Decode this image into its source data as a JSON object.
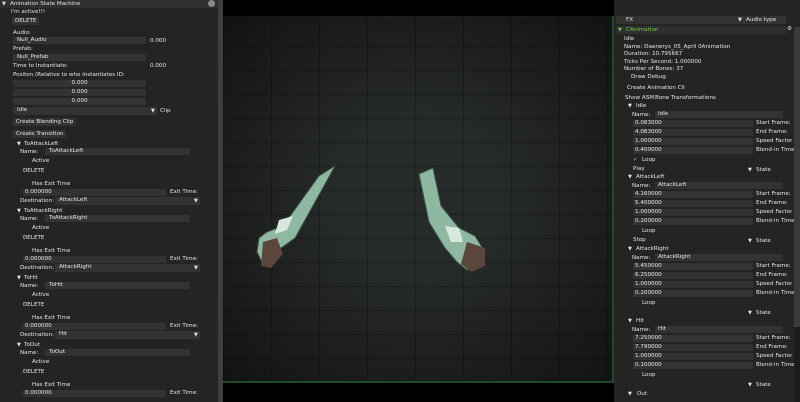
{
  "left_panel": {
    "title": "Animation State Machine",
    "active_label": "I'm active!!!",
    "delete_label": "DELETE",
    "audio_label": "Audio:",
    "audio_name": "Null_Audio",
    "audio_value": "0.000",
    "prefab_label": "Prefab:",
    "prefab_name": "Null_Prefab",
    "time_label": "Time to Instantiate:",
    "time_value": "0.000",
    "position_label": "Positon (Relative to who instantiates ID:",
    "pos_x": "0.000",
    "pos_y": "0.000",
    "pos_z": "0.000",
    "state_select": "Idle",
    "clip_label": "Clip",
    "create_blending": "Create Blending Clip",
    "create_transition": "Create Transition",
    "transitions": [
      {
        "header": "ToAttackLeft",
        "name_label": "Name:",
        "name": "ToAttackLeft",
        "active": "Active",
        "delete": "DELETE",
        "exit_label": "Has Exit Time",
        "time": "0.000000",
        "exit_time": "Exit Time:",
        "dest_label": "Destination:",
        "dest": "AttackLeft"
      },
      {
        "header": "ToAttackRight",
        "name_label": "Name:",
        "name": "ToAttackRight",
        "active": "Active",
        "delete": "DELETE",
        "exit_label": "Has Exit Time",
        "time": "0.000000",
        "exit_time": "Exit Time:",
        "dest_label": "Destination:",
        "dest": "AttackRight"
      },
      {
        "header": "ToHit",
        "name_label": "Name:",
        "name": "ToHit",
        "active": "Active",
        "delete": "DELETE",
        "exit_label": "Has Exit Time",
        "time": "0.000000",
        "exit_time": "Exit Time:",
        "dest_label": "Destination:",
        "dest": "Hit"
      },
      {
        "header": "ToOut",
        "name_label": "Name:",
        "name": "ToOut",
        "active": "Active",
        "delete": "DELETE",
        "exit_label": "Has Exit Time",
        "time": "0.000000",
        "exit_time": "Exit Time:"
      }
    ]
  },
  "right_panel": {
    "fx_select": "FX",
    "audio_type": "Audio type",
    "component": "CAnimation",
    "state": "Idle",
    "name_line": "Name: Daenerys_05_April 0Animation",
    "duration": "Duration: 10.795667",
    "ticks": "Ticks Per Second: 1.000000",
    "bones": "Number of Bones: 37",
    "draw_debug": "Draw Debug",
    "create_anim": "Create Animation Cli",
    "show_asm": "Show ASM",
    "bone_transforms": "Bone Transformations",
    "labels": {
      "name": "Name:",
      "start": "Start Frame:",
      "end": "End Frame:",
      "speed": "Speed Factor",
      "blend": "Blend-in Time",
      "state": "State"
    },
    "clips": [
      {
        "header": "Idle",
        "name": "Idle",
        "start": "0.083000",
        "end": "4.083000",
        "speed": "1.000000",
        "blend": "0.400000",
        "loop": "Loop",
        "action": "Play"
      },
      {
        "header": "AttackLeft",
        "name": "AttackLeft",
        "start": "4.160000",
        "end": "5.400000",
        "speed": "1.000000",
        "blend": "0.200000",
        "loop": "Loop",
        "action": "Stop"
      },
      {
        "header": "AttackRight",
        "name": "AttackRight",
        "start": "5.450000",
        "end": "6.250000",
        "speed": "1.000000",
        "blend": "0.200000",
        "loop": "Loop"
      },
      {
        "header": "Hit",
        "name": "Hit",
        "start": "7.250000",
        "end": "7.790000",
        "speed": "1.000000",
        "blend": "0.100000",
        "loop": "Loop"
      }
    ],
    "out_header": "Out"
  },
  "colors": {
    "panel": "#242424",
    "field": "#333333",
    "accent_green": "#78c850",
    "viewport": "#262a28"
  }
}
